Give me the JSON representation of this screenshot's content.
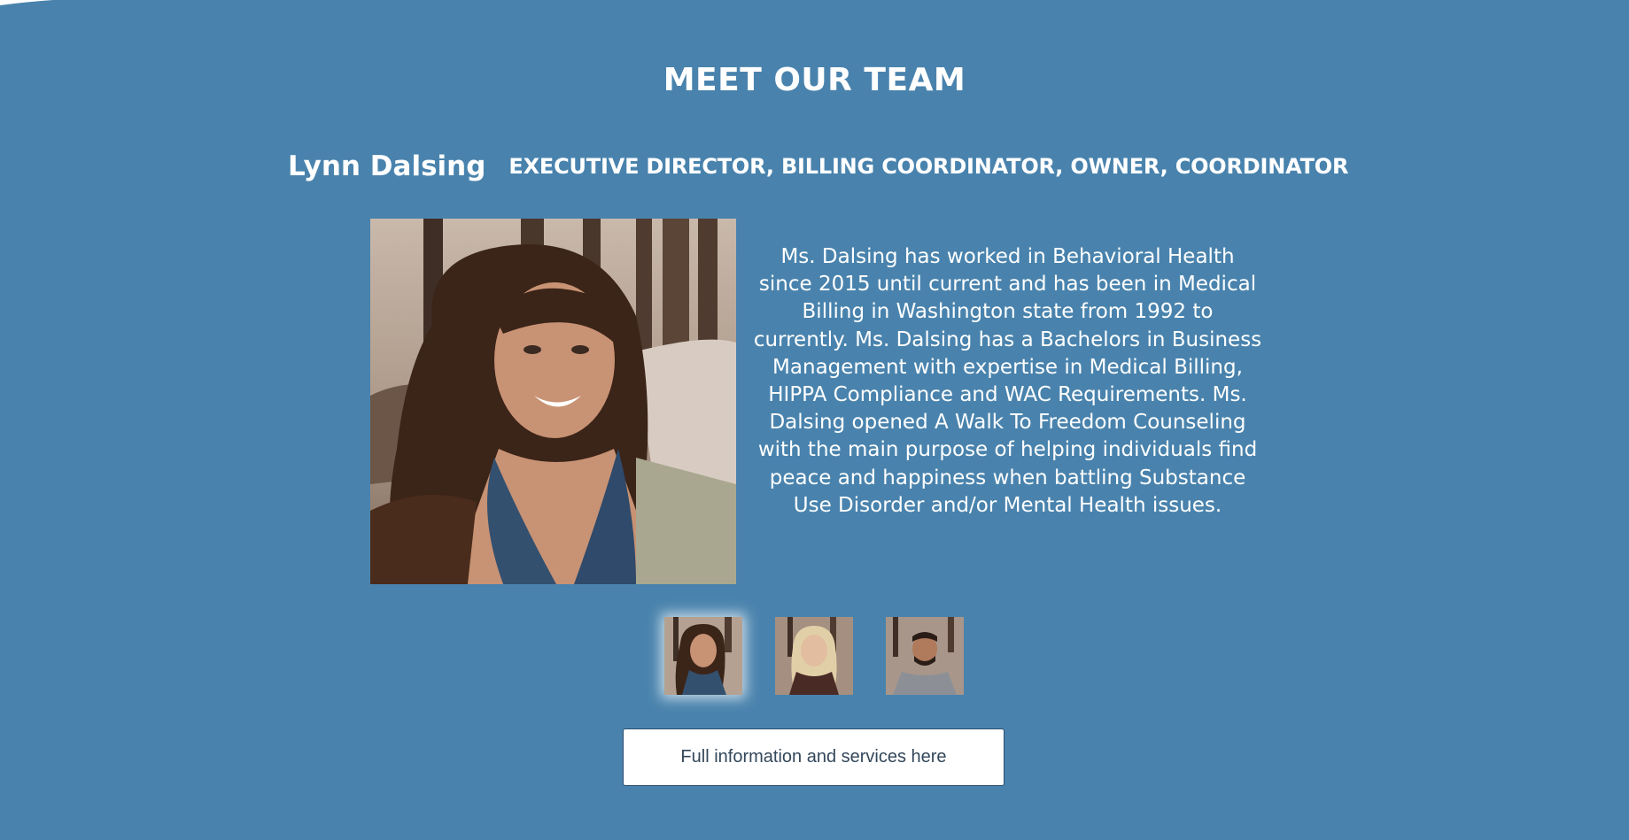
{
  "section": {
    "title": "MEET OUR TEAM"
  },
  "member": {
    "name": "Lynn Dalsing",
    "role": "EXECUTIVE DIRECTOR, BILLING COORDINATOR, OWNER, COORDINATOR",
    "bio": "Ms. Dalsing has worked in Behavioral Health since 2015 until current and has been in Medical Billing in Washington state from 1992 to currently. Ms. Dalsing has a Bachelors in Business Management with expertise in Medical Billing, HIPPA Compliance and WAC Requirements. Ms. Dalsing opened A Walk To Freedom Counseling with the main purpose of helping individuals find peace and happiness when battling Substance Use Disorder and/or Mental Health issues."
  },
  "thumbnails": [
    {
      "id": "thumb-1",
      "active": true
    },
    {
      "id": "thumb-2",
      "active": false
    },
    {
      "id": "thumb-3",
      "active": false
    }
  ],
  "cta": {
    "label": "Full information and services here"
  },
  "colors": {
    "background": "#4983ad",
    "text": "#ffffff",
    "button_text": "#33475b"
  }
}
